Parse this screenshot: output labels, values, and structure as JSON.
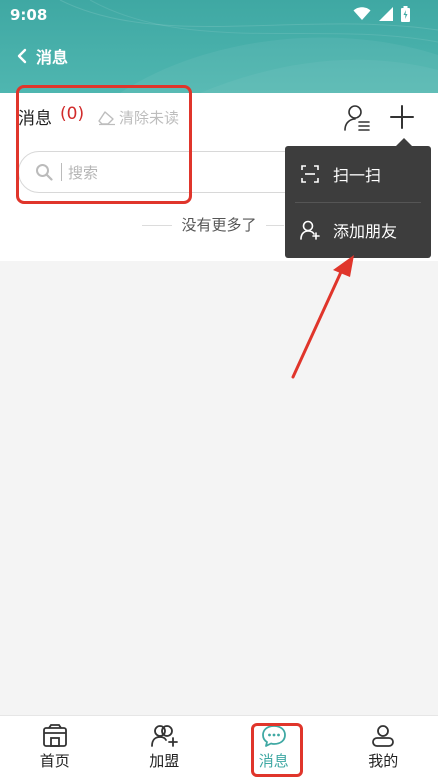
{
  "status_bar": {
    "time": "9:08"
  },
  "header": {
    "title": "消息",
    "back_icon": "chevron-left-icon"
  },
  "toolbar": {
    "title": "消息",
    "count": "(0)",
    "clear_unread": "清除未读",
    "contacts_icon": "contacts-icon",
    "add_icon": "plus-icon"
  },
  "search": {
    "placeholder": "搜索"
  },
  "list": {
    "end_text": "没有更多了"
  },
  "dropdown": {
    "items": [
      {
        "label": "扫一扫",
        "icon": "scan-icon"
      },
      {
        "label": "添加朋友",
        "icon": "add-friend-icon"
      }
    ]
  },
  "bottom_nav": {
    "items": [
      {
        "label": "首页",
        "icon": "home-icon"
      },
      {
        "label": "加盟",
        "icon": "join-icon"
      },
      {
        "label": "消息",
        "icon": "message-icon",
        "active": true
      },
      {
        "label": "我的",
        "icon": "profile-icon"
      }
    ]
  },
  "colors": {
    "accent": "#3fa8a3",
    "count": "#d12b2b",
    "annotation": "#e0352b",
    "menu_bg": "#3d3d3d"
  }
}
